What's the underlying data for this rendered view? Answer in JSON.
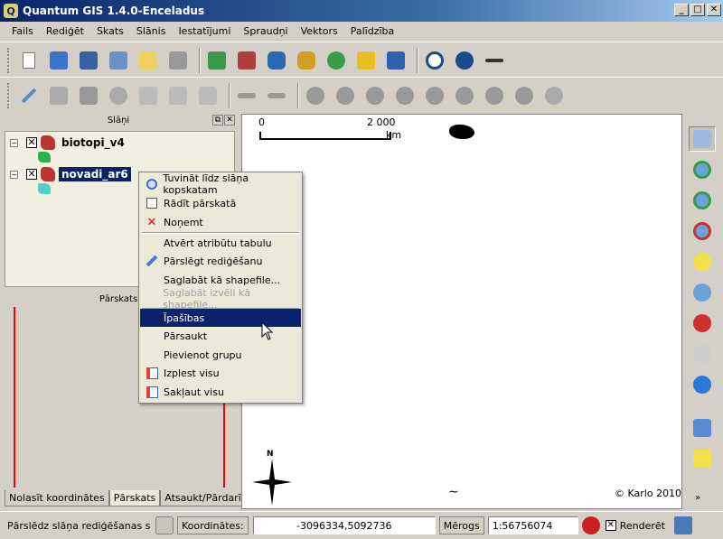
{
  "window": {
    "title": "Quantum GIS 1.4.0-Enceladus",
    "app_icon_glyph": "Q"
  },
  "window_buttons": [
    "_",
    "□",
    "✕"
  ],
  "menu": [
    "Fails",
    "Rediģēt",
    "Skats",
    "Slānis",
    "Iestatījumi",
    "Spraudņi",
    "Vektors",
    "Palīdzība"
  ],
  "toolbar_row1_icons": [
    "new-project-icon",
    "open-project-icon",
    "save-project-icon",
    "save-as-icon",
    "new-print-composer-icon",
    "print-icon",
    "add-vector-layer-icon",
    "add-raster-layer-icon",
    "add-postgis-layer-icon",
    "add-spatialite-layer-icon",
    "add-wms-layer-icon",
    "new-vector-layer-icon",
    "remove-layer-icon",
    "copyright-label-icon",
    "north-arrow-icon",
    "scale-bar-icon"
  ],
  "toolbar_row2_icons": [
    "toggle-editing-icon",
    "move-feature-icon",
    "node-tool-icon",
    "delete-selected-icon",
    "cut-features-icon",
    "copy-features-icon",
    "paste-features-icon",
    "undo-icon",
    "redo-icon",
    "simplify-feature-icon",
    "add-ring-icon",
    "add-island-icon",
    "delete-ring-icon",
    "delete-part-icon",
    "reshape-features-icon",
    "split-features-icon",
    "merge-features-icon",
    "rotate-point-symbols-icon"
  ],
  "layers_panel": {
    "title": "Slāņi",
    "dock_buttons": [
      "⧉",
      "✕"
    ],
    "layers": [
      {
        "name": "biotopi_v4",
        "checked": "✕",
        "expander": "−",
        "legend_color": "#2bb24c",
        "selected": false
      },
      {
        "name": "novadi_ar6",
        "checked": "✕",
        "expander": "−",
        "legend_color": "#4fd1c5",
        "selected": true
      }
    ]
  },
  "overview_panel": {
    "title": "Pārskats"
  },
  "bottom_tabs": [
    "Nolasīt koordinātes",
    "Pārskats",
    "Atsaukt/Pārdarīt"
  ],
  "context_menu": {
    "items": [
      {
        "label": "Tuvināt līdz slāņa kopskatam",
        "icon": "zoom-to-layer-icon",
        "state": "normal"
      },
      {
        "label": "Rādīt pārskatā",
        "icon": "checkbox-icon",
        "state": "normal"
      },
      {
        "label": "Noņemt",
        "icon": "remove-icon",
        "state": "normal"
      },
      {
        "label": "Atvērt atribūtu tabulu",
        "icon": "",
        "state": "normal"
      },
      {
        "label": "Pārslēgt rediģēšanu",
        "icon": "pencil-icon",
        "state": "normal"
      },
      {
        "label": "Saglabāt kā shapefile...",
        "icon": "",
        "state": "normal"
      },
      {
        "label": "Saglabāt izvēli kā shapefile...",
        "icon": "",
        "state": "disabled"
      },
      {
        "label": "Īpašības",
        "icon": "",
        "state": "highlight"
      },
      {
        "label": "Pārsaukt",
        "icon": "",
        "state": "normal"
      },
      {
        "label": "Pievienot grupu",
        "icon": "",
        "state": "normal"
      },
      {
        "label": "Izplest visu",
        "icon": "expand-all-icon",
        "state": "normal"
      },
      {
        "label": "Sakļaut visu",
        "icon": "collapse-all-icon",
        "state": "normal"
      }
    ]
  },
  "map": {
    "scale_start": "0",
    "scale_end": "2 000",
    "scale_unit": "km",
    "north_label": "N",
    "copyright": "© Karlo 2010"
  },
  "right_toolbar_icons": [
    "pan-icon",
    "zoom-in-icon",
    "zoom-out-icon",
    "zoom-full-icon",
    "zoom-to-selection-icon",
    "zoom-to-layer-icon",
    "zoom-last-icon",
    "zoom-actual-icon",
    "refresh-icon",
    "identify-icon",
    "select-features-icon"
  ],
  "statusbar": {
    "message": "Pārslēdz slāņa rediģēšanas statusu",
    "coordinates_label": "Koordinātes:",
    "coordinates_value": "-3096334,5092736",
    "scale_label": "Mērogs",
    "scale_value": "1:56756074",
    "render_label": "Renderēt",
    "render_checked": "✕"
  },
  "colors": {
    "highlight": "#0a246a",
    "title_gradient_start": "#0a246a",
    "overview_line": "#ff0000"
  }
}
